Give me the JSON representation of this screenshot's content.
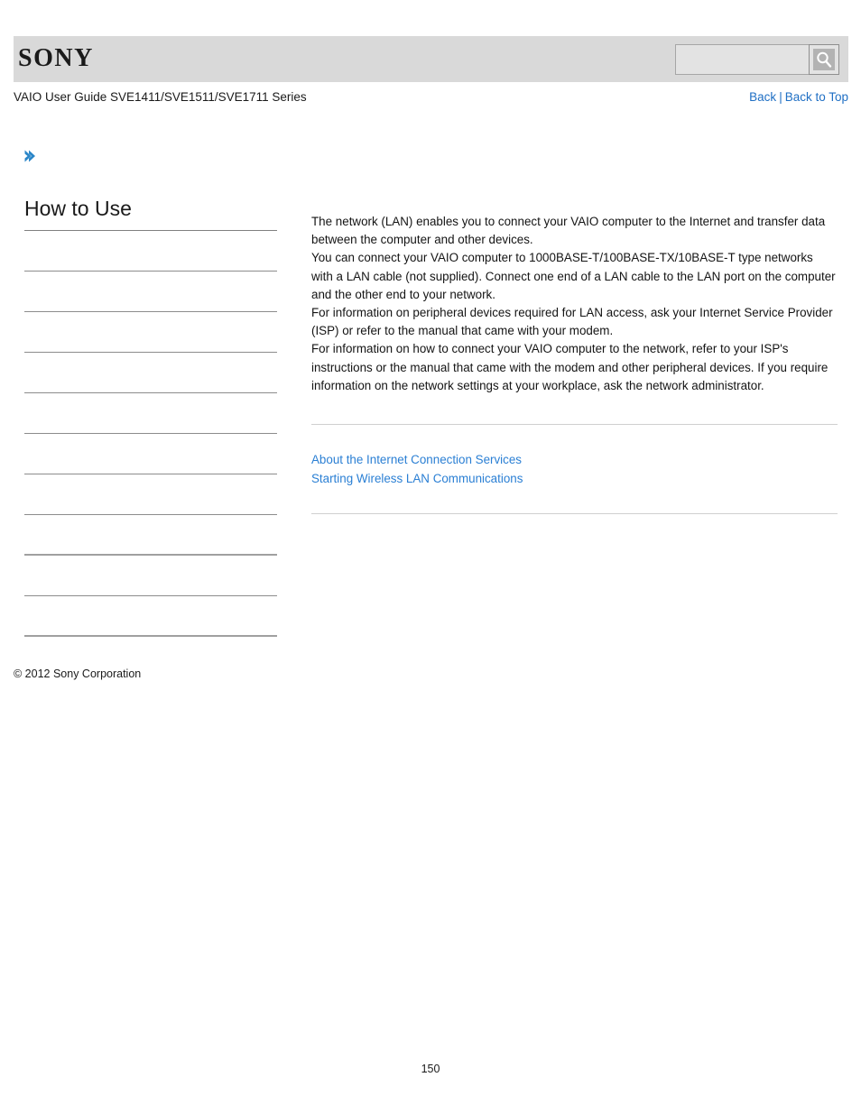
{
  "header": {
    "logo_text": "SONY",
    "search": {
      "value": "",
      "placeholder": "",
      "button_icon": "search-icon"
    }
  },
  "subheader": {
    "guide_title": "VAIO User Guide SVE1411/SVE1511/SVE1711 Series",
    "back_label": "Back",
    "separator": "|",
    "back_to_top_label": "Back to Top"
  },
  "breadcrumb": {
    "icon": "chevron-right-icon",
    "label": ""
  },
  "sidebar": {
    "heading": "How to Use",
    "items": [
      {
        "label": ""
      },
      {
        "label": ""
      },
      {
        "label": ""
      },
      {
        "label": ""
      },
      {
        "label": ""
      },
      {
        "label": ""
      },
      {
        "label": ""
      },
      {
        "label": ""
      },
      {
        "label": ""
      },
      {
        "label": ""
      }
    ]
  },
  "main": {
    "paragraphs": [
      "The network (LAN) enables you to connect your VAIO computer to the Internet and transfer data between the computer and other devices.",
      "You can connect your VAIO computer to 1000BASE-T/100BASE-TX/10BASE-T type networks with a LAN cable (not supplied). Connect one end of a LAN cable to the LAN port on the computer and the other end to your network.",
      "For information on peripheral devices required for LAN access, ask your Internet Service Provider (ISP) or refer to the manual that came with your modem.",
      "For information on how to connect your VAIO computer to the network, refer to your ISP's instructions or the manual that came with the modem and other peripheral devices. If you require information on the network settings at your workplace, ask the network administrator."
    ],
    "related_links": [
      "About the Internet Connection Services",
      "Starting Wireless LAN Communications"
    ]
  },
  "footer": {
    "copyright": "© 2012 Sony Corporation",
    "page_number": "150"
  },
  "colors": {
    "header_band": "#d9d9d9",
    "link_blue": "#2a7fd4",
    "nav_link_blue": "#1f6fc4",
    "chevron_blue": "#2b86c8",
    "rule_gray": "#8c8c8c",
    "content_rule": "#cfcfcf"
  }
}
